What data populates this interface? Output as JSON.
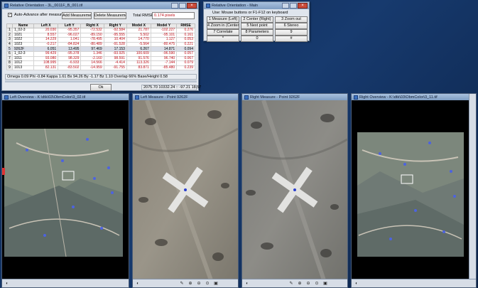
{
  "ro_window": {
    "title": "Relative Orientation - 3L_0011F_B_001.tif",
    "auto_advance_label": "Auto-Advance after measurement",
    "auto_advance_checked": "✓",
    "add_button": "Add Measurement",
    "delete_button": "Delete Measurement",
    "total_rmse_label": "Total RMSE:",
    "total_rmse_value": "0.174 pixels",
    "columns": [
      "Name",
      "Left X",
      "Left Y",
      "Right X",
      "Right Y",
      "Model X",
      "Model Y",
      "RMSE"
    ],
    "rows": [
      {
        "idx": "1",
        "name": "1_02-3",
        "lx": "20.030",
        "ly": "-95.357",
        "rx": "-72.532",
        "ry": "-92.584",
        "mx": "21.787",
        "my": "-102.227",
        "rmse": "0.276"
      },
      {
        "idx": "2",
        "name": "1021",
        "lx": "8.557",
        "ly": "-96.027",
        "rx": "-89.150",
        "ry": "-95.555",
        "mx": "5.502",
        "my": "-95.101",
        "rmse": "0.161"
      },
      {
        "idx": "3",
        "name": "1022",
        "lx": "14.229",
        "ly": "1.041",
        "rx": "-78.495",
        "ry": "10.404",
        "mx": "14.770",
        "my": "1.127",
        "rmse": "0.053"
      },
      {
        "idx": "4",
        "name": "1023",
        "lx": "-0.217",
        "ly": "-84.824",
        "rx": "-80.489",
        "ry": "-91.528",
        "mx": "-5.564",
        "my": "-80.475",
        "rmse": "0.221"
      },
      {
        "idx": "5",
        "name": "9262F",
        "lx": "6.051",
        "ly": "13.495",
        "rx": "97.469",
        "ry": "17.153",
        "mx": "6.267",
        "my": "14.871",
        "rmse": "0.094"
      },
      {
        "idx": "6",
        "name": "1_02-3",
        "lx": "99.429",
        "ly": "-95.378",
        "rx": "1.346",
        "ry": "-93.925",
        "mx": "100.609",
        "my": "-96.590",
        "rmse": "0.057"
      },
      {
        "idx": "7",
        "name": "1011",
        "lx": "93.080",
        "ly": "98.329",
        "rx": "-2.160",
        "ry": "98.591",
        "mx": "91.576",
        "my": "96.740",
        "rmse": "0.067"
      },
      {
        "idx": "8",
        "name": "1012",
        "lx": "108.995",
        "ly": "-6.933",
        "rx": "14.566",
        "ry": "-4.414",
        "mx": "113.326",
        "my": "-7.144",
        "rmse": "0.079"
      },
      {
        "idx": "9",
        "name": "1013",
        "lx": "82.131",
        "ly": "-83.502",
        "rx": "-14.959",
        "ry": "-91.755",
        "mx": "83.871",
        "my": "-85.480",
        "rmse": "0.239"
      }
    ],
    "params": "Omega 0.09   Phi -0.84   Kappa 1.61   Bx 94.26   By -1.17   Bz 1.10   Overlap 66%   Base/Height 0.58",
    "ok_button": "Ok",
    "status_coords": "2075.70 10332.24 :: -97.21 18.57"
  },
  "main_window": {
    "title": "Relative Orientation - Main",
    "hint": "Use: Mouse buttons  or  F1-F12 on keyboard",
    "buttons": [
      [
        "1 Measure (Left)",
        "2 Center (Right)",
        "3 Zoom out"
      ],
      [
        "4 Zoom in (Center)",
        "5 Next point",
        "6 Stereo"
      ],
      [
        "7 Correlate",
        "8 Parameters",
        "9"
      ],
      [
        "*",
        "0",
        "#"
      ]
    ]
  },
  "panels": {
    "left_overview": "Left Overview - K:\\dtk\\03\\ObmColor\\3_02.tif",
    "left_measure": "Left Measure - Point 9262F",
    "right_measure": "Right Measure - Point 9262F",
    "right_overview": "Right Overview - K:\\dtk\\03\\ObmColor\\3_11.tif"
  },
  "colors": {
    "rmse_red": "#c0101a",
    "title_blue": "#7f9dc2",
    "desktop": "#0e2a55"
  },
  "icons": [
    "contrast-icon",
    "wrench-icon",
    "zoom-in-icon",
    "zoom-out-icon",
    "zoom-fit-icon",
    "image-icon"
  ]
}
